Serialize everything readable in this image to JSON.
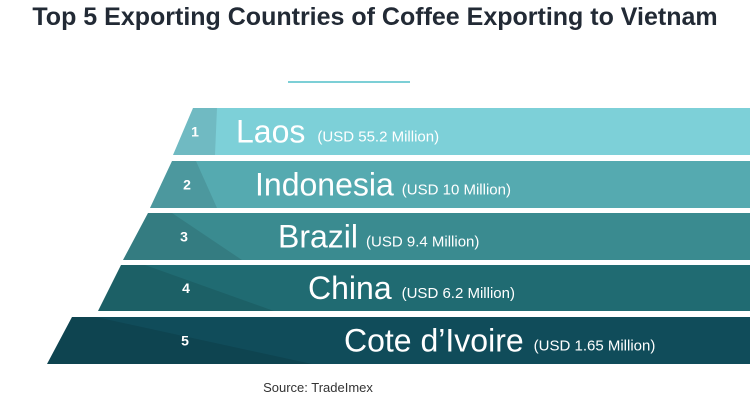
{
  "title": "Top 5 Exporting Countries of Coffee Exporting to Vietnam",
  "source": "Source: TradeImex",
  "colors": [
    "#7dd0d8",
    "#55aab0",
    "#3a8b90",
    "#206b72",
    "#104c5a"
  ],
  "chart_data": {
    "type": "table",
    "title": "Top 5 Exporting Countries of Coffee Exporting to Vietnam",
    "rows": [
      {
        "rank": "1",
        "country": "Laos",
        "value_label": "(USD 55.2 Million)",
        "value": 55.2
      },
      {
        "rank": "2",
        "country": "Indonesia",
        "value_label": "(USD 10 Million)",
        "value": 10
      },
      {
        "rank": "3",
        "country": "Brazil",
        "value_label": "(USD 9.4 Million)",
        "value": 9.4
      },
      {
        "rank": "4",
        "country": "China",
        "value_label": "(USD 6.2 Million)",
        "value": 6.2
      },
      {
        "rank": "5",
        "country": "Cote d’Ivoire",
        "value_label": "(USD 1.65 Million)",
        "value": 1.65
      }
    ]
  }
}
